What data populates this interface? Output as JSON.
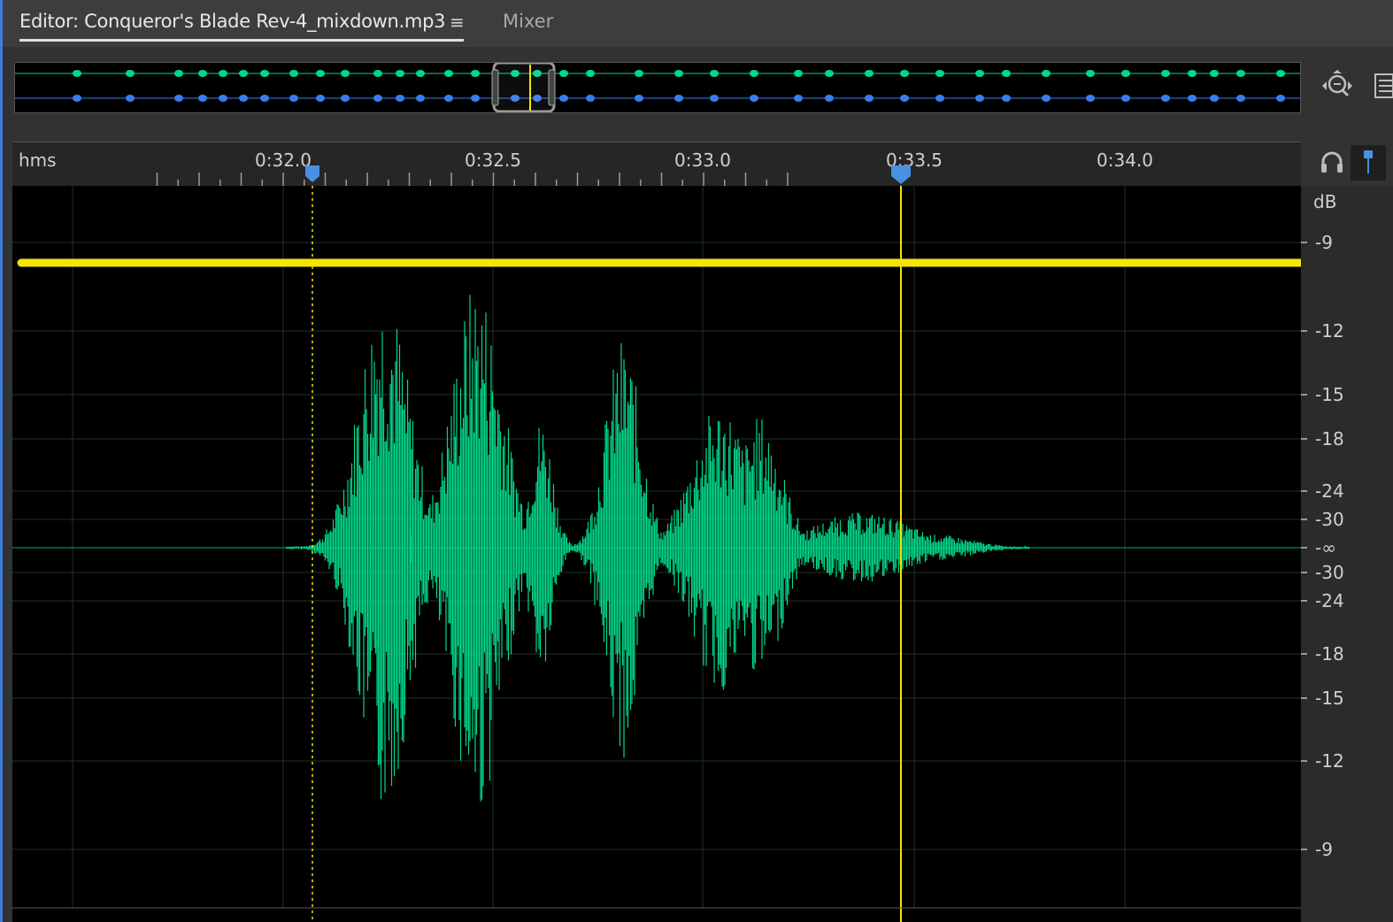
{
  "tabs": {
    "editor_label": "Editor: Conqueror's Blade Rev-4_mixdown.mp3",
    "menu_glyph": "≡",
    "mixer_label": "Mixer"
  },
  "ruler": {
    "unit": "hms",
    "labels": [
      "0:32.0",
      "0:32.5",
      "0:33.0",
      "0:33.5",
      "0:34.0"
    ]
  },
  "db_scale": {
    "unit": "dB",
    "labels": [
      "-9",
      "-12",
      "-15",
      "-18",
      "-24",
      "-30",
      "-∞",
      "-30",
      "-24",
      "-18",
      "-15",
      "-12",
      "-9"
    ]
  },
  "colors": {
    "waveform": "#00d98b",
    "overview_top": "#00d98b",
    "overview_bottom": "#3a7cf0",
    "threshold": "#f5e400",
    "playhead": "#f5e400",
    "marker": "#4a90e2",
    "accent": "#3b7fd6"
  },
  "icons": {
    "menu": "hamburger-menu-icon",
    "zoom_nav": "zoom-navigator-icon",
    "list": "list-icon",
    "headphone": "headphone-icon",
    "pin": "marker-pin-icon"
  }
}
